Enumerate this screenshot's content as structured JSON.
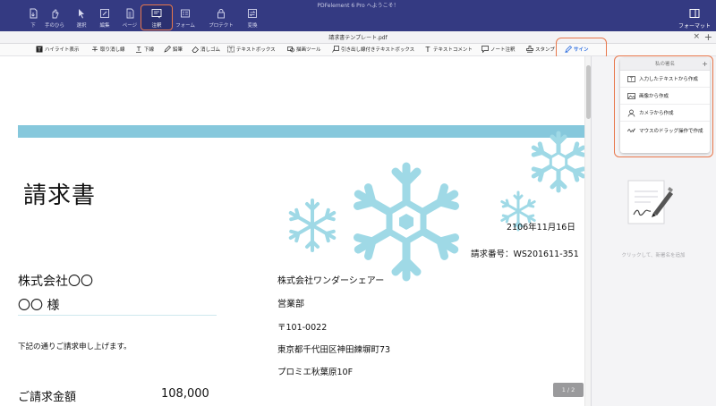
{
  "app": {
    "title": "PDFelement 6 Pro へようこそ！"
  },
  "toolbar": {
    "items": [
      {
        "label": "下",
        "icon": "page-down-icon"
      },
      {
        "label": "手のひら",
        "icon": "hand-icon"
      },
      {
        "label": "選択",
        "icon": "pointer-icon"
      },
      {
        "label": "編集",
        "icon": "edit-icon"
      },
      {
        "label": "ページ",
        "icon": "page-icon"
      },
      {
        "label": "注釈",
        "icon": "annotate-icon"
      },
      {
        "label": "フォーム",
        "icon": "form-icon"
      },
      {
        "label": "プロテクト",
        "icon": "protect-icon"
      },
      {
        "label": "変換",
        "icon": "convert-icon"
      }
    ],
    "format_label": "フォーマット"
  },
  "tabs": {
    "active": "請求書テンプレート.pdf",
    "close": "×",
    "add": "+"
  },
  "annotation_toolbar": {
    "tools": [
      {
        "label": "ハイライト表示",
        "icon": "highlight-icon"
      },
      {
        "label": "取り消し線",
        "icon": "strikethrough-icon"
      },
      {
        "label": "下線",
        "icon": "underline-icon"
      },
      {
        "label": "鉛筆",
        "icon": "pencil-icon"
      },
      {
        "label": "消しゴム",
        "icon": "eraser-icon"
      },
      {
        "label": "テキストボックス",
        "icon": "textbox-icon"
      },
      {
        "label": "描画ツール",
        "icon": "shape-icon"
      },
      {
        "label": "引き出し線付きテキストボックス",
        "icon": "callout-icon"
      },
      {
        "label": "テキストコメント",
        "icon": "text-comment-icon"
      },
      {
        "label": "ノート注釈",
        "icon": "note-icon"
      },
      {
        "label": "スタンプ",
        "icon": "stamp-icon"
      },
      {
        "label": "サイン",
        "icon": "sign-pen-icon"
      }
    ]
  },
  "document": {
    "title": "請求書",
    "bill_to": {
      "company": "株式会社〇〇",
      "person": "〇〇 様"
    },
    "greeting": "下記の通りご請求申し上げます。",
    "total": {
      "label": "ご請求金額",
      "value": "108,000"
    },
    "issuer": {
      "company": "株式会社ワンダーシェアー",
      "dept": "営業部",
      "zip": "〒101-0022",
      "address": "東京都千代田区神田練塀町73",
      "building": "プロミエ秋葉原10F"
    },
    "date": "2106年11月16日",
    "number": "請求番号：WS201611-351",
    "page_indicator": "1 / 2"
  },
  "signature_panel": {
    "header": "私の署名",
    "plus": "+",
    "options": [
      {
        "label": "入力したテキストから作成",
        "icon": "text-sign-icon"
      },
      {
        "label": "画像から作成",
        "icon": "image-icon"
      },
      {
        "label": "カメラから作成",
        "icon": "camera-icon"
      },
      {
        "label": "マウスのドラッグ操作で作成",
        "icon": "mouse-draw-icon"
      }
    ],
    "hint": "クリックして、新署名を追加"
  },
  "colors": {
    "toolbar_bg": "#343a82",
    "highlight_orange": "#e8774b",
    "accent_blue": "#2f6fe0",
    "band_blue": "#86c8dc",
    "snowflake_blue": "#9fd9e6"
  }
}
